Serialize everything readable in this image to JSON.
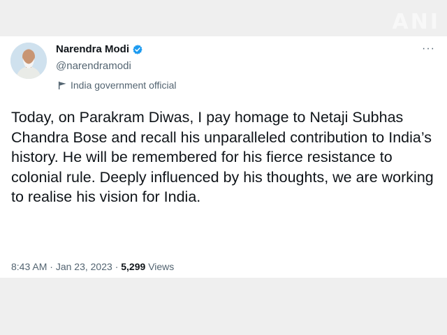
{
  "watermark": "ANI",
  "author": {
    "name": "Narendra Modi",
    "handle": "@narendramodi",
    "affiliation": "India government official",
    "verified_icon": "verified-badge-icon",
    "affiliation_icon": "flag-icon"
  },
  "menu": {
    "more_label": "···"
  },
  "tweet": {
    "text": "Today, on Parakram Diwas, I pay homage to Netaji Subhas Chandra Bose and recall his unparalleled contribution to India’s history. He will be remembered for his fierce resistance to colonial rule. Deeply influenced by his thoughts, we are working to realise his vision for India."
  },
  "meta": {
    "time": "8:43 AM",
    "separator": "·",
    "date": "Jan 23, 2023",
    "views_count": "5,299",
    "views_label": "Views"
  },
  "colors": {
    "verified": "#1d9bf0",
    "secondary_text": "#536471",
    "primary_text": "#0f1419"
  }
}
